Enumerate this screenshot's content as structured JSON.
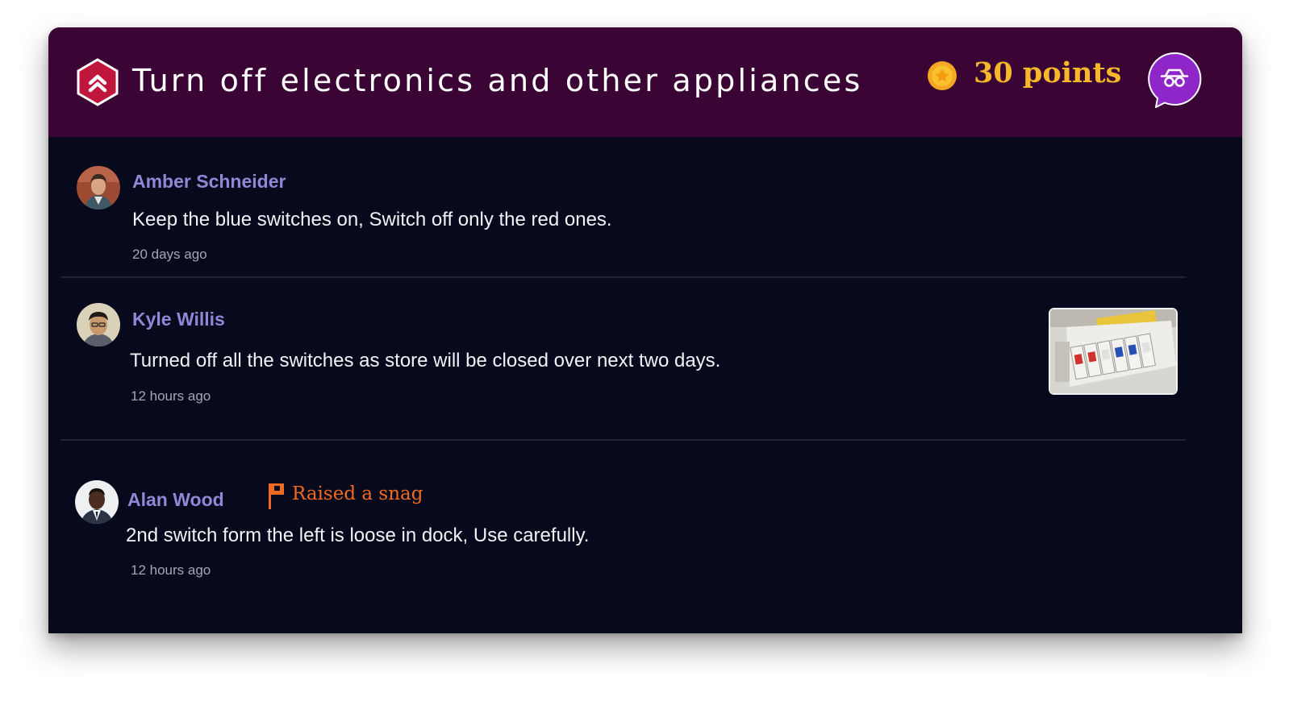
{
  "task": {
    "title": "Turn off electronics and other appliances",
    "icon": "priority-chevron-up-icon",
    "points_label": "30 points",
    "coin_icon": "gold-coin-icon",
    "spy_icon": "incognito-glasses-icon"
  },
  "colors": {
    "header_bg": "#3a0434",
    "card_bg": "#060a1c",
    "author": "#8f88d6",
    "points": "#f7b72b",
    "snag": "#f06a1f",
    "task_icon": "#c0163c",
    "spy_button": "#8e26c9"
  },
  "comments": [
    {
      "author": "Amber Schneider",
      "text": "Keep the blue switches on, Switch off only the red ones.",
      "time": "20 days ago"
    },
    {
      "author": "Kyle Willis",
      "text": "Turned off all the switches as store will be closed over next two days.",
      "time": "12 hours ago",
      "attachment": "switchboard-photo"
    },
    {
      "author": "Alan Wood",
      "badge": "Raised a snag",
      "badge_icon": "flag-icon",
      "text": "2nd switch form the left is loose in dock, Use carefully.",
      "time": "12 hours ago"
    }
  ]
}
